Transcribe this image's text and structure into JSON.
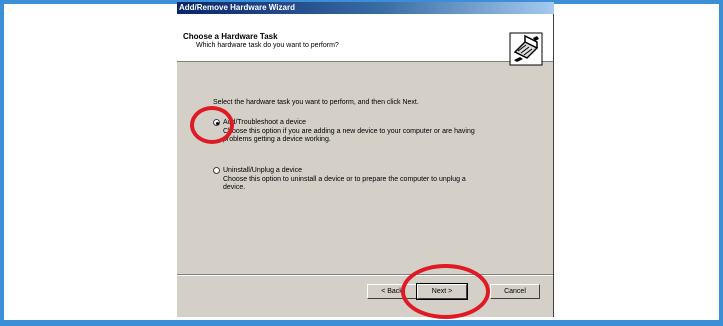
{
  "window": {
    "title": "Add/Remove Hardware Wizard"
  },
  "header": {
    "title": "Choose a Hardware Task",
    "subtitle": "Which hardware task do you want to perform?",
    "icon": "hardware-wizard-icon"
  },
  "content": {
    "instruction": "Select the hardware task you want to perform, and then click Next.",
    "options": [
      {
        "label": "Add/Troubleshoot a device",
        "description_line1": "Choose this option if you are adding a new device to your computer or are having",
        "description_line2": "problems getting a device working.",
        "selected": true
      },
      {
        "label": "Uninstall/Unplug a device",
        "description_line1": "Choose this option to uninstall a device or to prepare the computer to unplug a",
        "description_line2": "device.",
        "selected": false
      }
    ]
  },
  "buttons": {
    "back": "< Back",
    "next": "Next >",
    "cancel": "Cancel"
  },
  "annotations": {
    "highlight_color": "#e01a24"
  },
  "colors": {
    "frame_border": "#3b8fd6",
    "dialog_face": "#d4d0c8",
    "titlebar_start": "#0a246a",
    "titlebar_end": "#a6caf0"
  }
}
